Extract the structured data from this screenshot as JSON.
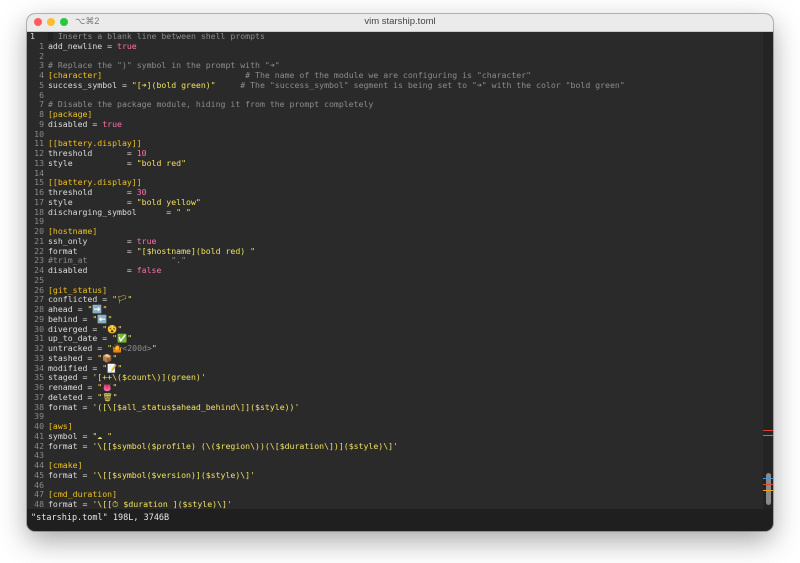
{
  "window": {
    "title": "vim starship.toml",
    "shortcut": "⌥⌘2"
  },
  "status_line": "\"starship.toml\" 198L, 3746B",
  "colors": {
    "comment": "#8c8c8c",
    "section": "#f0c020",
    "string": "#f0e060",
    "value": "#ff6fb0"
  },
  "lines": [
    {
      "n": "1",
      "parts": [
        [
          "cur",
          "█"
        ],
        [
          "cm",
          " Inserts a blank line between shell prompts"
        ]
      ]
    },
    {
      "n": "1",
      "parts": [
        [
          "key",
          "add_newline = "
        ],
        [
          "val",
          "true"
        ]
      ]
    },
    {
      "n": "2",
      "parts": []
    },
    {
      "n": "3",
      "parts": [
        [
          "cm",
          "# Replace the \")\" symbol in the prompt with \"➜\""
        ]
      ]
    },
    {
      "n": "4",
      "parts": [
        [
          "sec",
          "[character]"
        ],
        [
          "cm",
          "                             # The name of the module we are configuring is \"character\""
        ]
      ]
    },
    {
      "n": "5",
      "parts": [
        [
          "key",
          "success_symbol = "
        ],
        [
          "str",
          "\"[➜](bold green)\""
        ],
        [
          "cm",
          "     # The \"success_symbol\" segment is being set to \"➜\" with the color \"bold green\""
        ]
      ]
    },
    {
      "n": "6",
      "parts": []
    },
    {
      "n": "7",
      "parts": [
        [
          "cm",
          "# Disable the package module, hiding it from the prompt completely"
        ]
      ]
    },
    {
      "n": "8",
      "parts": [
        [
          "sec",
          "[package]"
        ]
      ]
    },
    {
      "n": "9",
      "parts": [
        [
          "key",
          "disabled = "
        ],
        [
          "val",
          "true"
        ]
      ]
    },
    {
      "n": "10",
      "parts": []
    },
    {
      "n": "11",
      "parts": [
        [
          "sec",
          "[[battery.display]]"
        ]
      ]
    },
    {
      "n": "12",
      "parts": [
        [
          "key",
          "threshold       = "
        ],
        [
          "val",
          "10"
        ]
      ]
    },
    {
      "n": "13",
      "parts": [
        [
          "key",
          "style           = "
        ],
        [
          "str",
          "\"bold red\""
        ]
      ]
    },
    {
      "n": "14",
      "parts": []
    },
    {
      "n": "15",
      "parts": [
        [
          "sec",
          "[[battery.display]]"
        ]
      ]
    },
    {
      "n": "16",
      "parts": [
        [
          "key",
          "threshold       = "
        ],
        [
          "val",
          "30"
        ]
      ]
    },
    {
      "n": "17",
      "parts": [
        [
          "key",
          "style           = "
        ],
        [
          "str",
          "\"bold yellow\""
        ]
      ]
    },
    {
      "n": "18",
      "parts": [
        [
          "key",
          "discharging_symbol      = "
        ],
        [
          "str",
          "\" \""
        ]
      ]
    },
    {
      "n": "19",
      "parts": []
    },
    {
      "n": "20",
      "parts": [
        [
          "sec",
          "[hostname]"
        ]
      ]
    },
    {
      "n": "21",
      "parts": [
        [
          "key",
          "ssh_only        = "
        ],
        [
          "val",
          "true"
        ]
      ]
    },
    {
      "n": "22",
      "parts": [
        [
          "key",
          "format          = "
        ],
        [
          "str",
          "\"[$hostname](bold red) \""
        ]
      ]
    },
    {
      "n": "23",
      "parts": [
        [
          "cm",
          "#trim_at                 \".\""
        ]
      ]
    },
    {
      "n": "24",
      "parts": [
        [
          "key",
          "disabled        = "
        ],
        [
          "val",
          "false"
        ]
      ]
    },
    {
      "n": "25",
      "parts": []
    },
    {
      "n": "26",
      "parts": [
        [
          "sec",
          "[git_status]"
        ]
      ]
    },
    {
      "n": "27",
      "parts": [
        [
          "key",
          "conflicted = "
        ],
        [
          "str",
          "\"🏳\""
        ]
      ]
    },
    {
      "n": "28",
      "parts": [
        [
          "key",
          "ahead = "
        ],
        [
          "str",
          "\"➡️\""
        ]
      ]
    },
    {
      "n": "29",
      "parts": [
        [
          "key",
          "behind = "
        ],
        [
          "str",
          "\"⬅️\""
        ]
      ]
    },
    {
      "n": "30",
      "parts": [
        [
          "key",
          "diverged = "
        ],
        [
          "str",
          "\"😵\""
        ]
      ]
    },
    {
      "n": "31",
      "parts": [
        [
          "key",
          "up_to_date = "
        ],
        [
          "str",
          "\"✅\""
        ]
      ]
    },
    {
      "n": "32",
      "parts": [
        [
          "key",
          "untracked = "
        ],
        [
          "str",
          "\"🤷"
        ],
        [
          "cm",
          "<200d>"
        ],
        [
          "str",
          "\""
        ]
      ]
    },
    {
      "n": "33",
      "parts": [
        [
          "key",
          "stashed = "
        ],
        [
          "str",
          "\"📦\""
        ]
      ]
    },
    {
      "n": "34",
      "parts": [
        [
          "key",
          "modified = "
        ],
        [
          "str",
          "\"📝\""
        ]
      ]
    },
    {
      "n": "35",
      "parts": [
        [
          "key",
          "staged = "
        ],
        [
          "str",
          "'[++\\($count\\)](green)'"
        ]
      ]
    },
    {
      "n": "36",
      "parts": [
        [
          "key",
          "renamed = "
        ],
        [
          "str",
          "\"👅\""
        ]
      ]
    },
    {
      "n": "37",
      "parts": [
        [
          "key",
          "deleted = "
        ],
        [
          "str",
          "\"🗑\""
        ]
      ]
    },
    {
      "n": "38",
      "parts": [
        [
          "key",
          "format = "
        ],
        [
          "str",
          "'([\\[$all_status$ahead_behind\\]]($style))'"
        ]
      ]
    },
    {
      "n": "39",
      "parts": []
    },
    {
      "n": "40",
      "parts": [
        [
          "sec",
          "[aws]"
        ]
      ]
    },
    {
      "n": "41",
      "parts": [
        [
          "key",
          "symbol = "
        ],
        [
          "str",
          "\"☁ \""
        ]
      ]
    },
    {
      "n": "42",
      "parts": [
        [
          "key",
          "format = "
        ],
        [
          "str",
          "'\\[[$symbol($profile) (\\($region\\))(\\[$duration\\])]($style)\\]'"
        ]
      ]
    },
    {
      "n": "43",
      "parts": []
    },
    {
      "n": "44",
      "parts": [
        [
          "sec",
          "[cmake]"
        ]
      ]
    },
    {
      "n": "45",
      "parts": [
        [
          "key",
          "format = "
        ],
        [
          "str",
          "'\\[[$symbol($version)]($style)\\]'"
        ]
      ]
    },
    {
      "n": "46",
      "parts": []
    },
    {
      "n": "47",
      "parts": [
        [
          "sec",
          "[cmd_duration]"
        ]
      ]
    },
    {
      "n": "48",
      "parts": [
        [
          "key",
          "format = "
        ],
        [
          "str",
          "'\\[[⏱ $duration ]($style)\\]'"
        ]
      ]
    },
    {
      "n": "49",
      "parts": []
    }
  ]
}
